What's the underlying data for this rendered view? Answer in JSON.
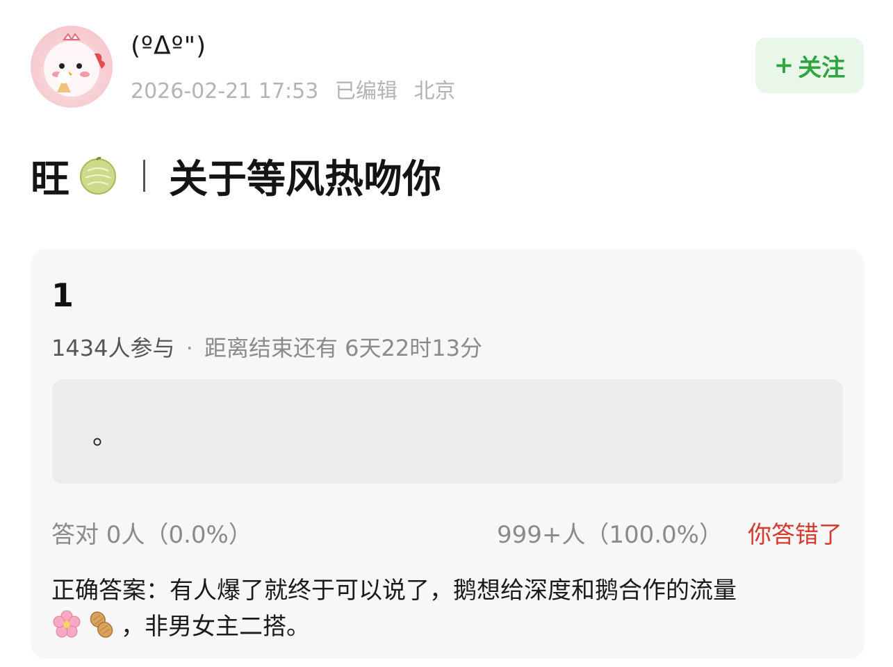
{
  "user": {
    "name": "(ºᐃº\")",
    "timestamp": "2026-02-21 17:53",
    "edited_label": "已编辑",
    "location": "北京"
  },
  "follow_button": {
    "plus": "+",
    "label": "关注"
  },
  "post": {
    "title_prefix": "旺",
    "title_icon": "melon-icon",
    "title_main": "关于等风热吻你"
  },
  "quiz": {
    "number": "1",
    "participants": "1434人参与",
    "separator": "·",
    "countdown": "距离结束还有 6天22时13分",
    "option_text": "。",
    "correct_result": "答对  0人（0.0%）",
    "wrong_result": "999+人（100.0%）",
    "wrong_label": "你答错了",
    "answer_line1": "正确答案：有人爆了就终于可以说了，鹅想给深度和鹅合作的流量",
    "answer_icons": [
      "cherry-blossom-icon",
      "peanut-icon"
    ],
    "answer_line2": "，非男女主二搭。"
  },
  "colors": {
    "follow_green": "#2ea53f",
    "follow_bg": "#e8f7ea",
    "wrong_red": "#d63a2e",
    "card_bg": "#f7f7f7"
  }
}
